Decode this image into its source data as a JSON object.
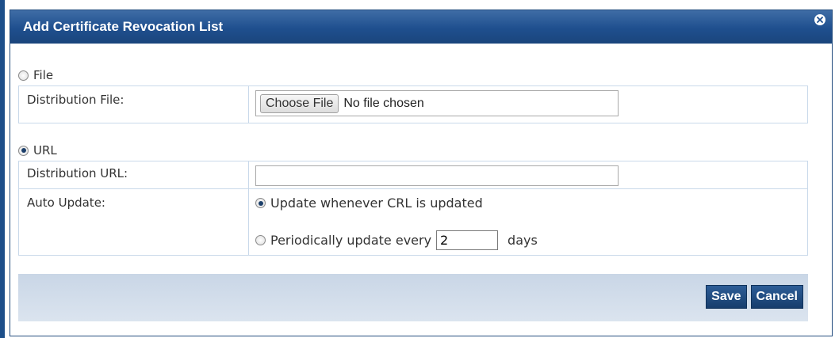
{
  "dialog": {
    "title": "Add Certificate Revocation List"
  },
  "file_section": {
    "radio_label": "File",
    "selected": false,
    "distribution_file_label": "Distribution File:",
    "choose_button_label": "Choose File",
    "file_status": "No file chosen"
  },
  "url_section": {
    "radio_label": "URL",
    "selected": true,
    "distribution_url_label": "Distribution URL:",
    "distribution_url_value": "",
    "auto_update_label": "Auto Update:",
    "option_on_update": "Update whenever CRL is updated",
    "option_periodic_prefix": "Periodically update every",
    "periodic_days_value": "2",
    "periodic_suffix": "days"
  },
  "buttons": {
    "save": "Save",
    "cancel": "Cancel"
  },
  "colors": {
    "title_bar": "#1f4f8e",
    "button": "#1d4a80",
    "table_border": "#c9d9ea",
    "footer": "#d2dde9"
  },
  "icons": {
    "close": "close-icon"
  }
}
